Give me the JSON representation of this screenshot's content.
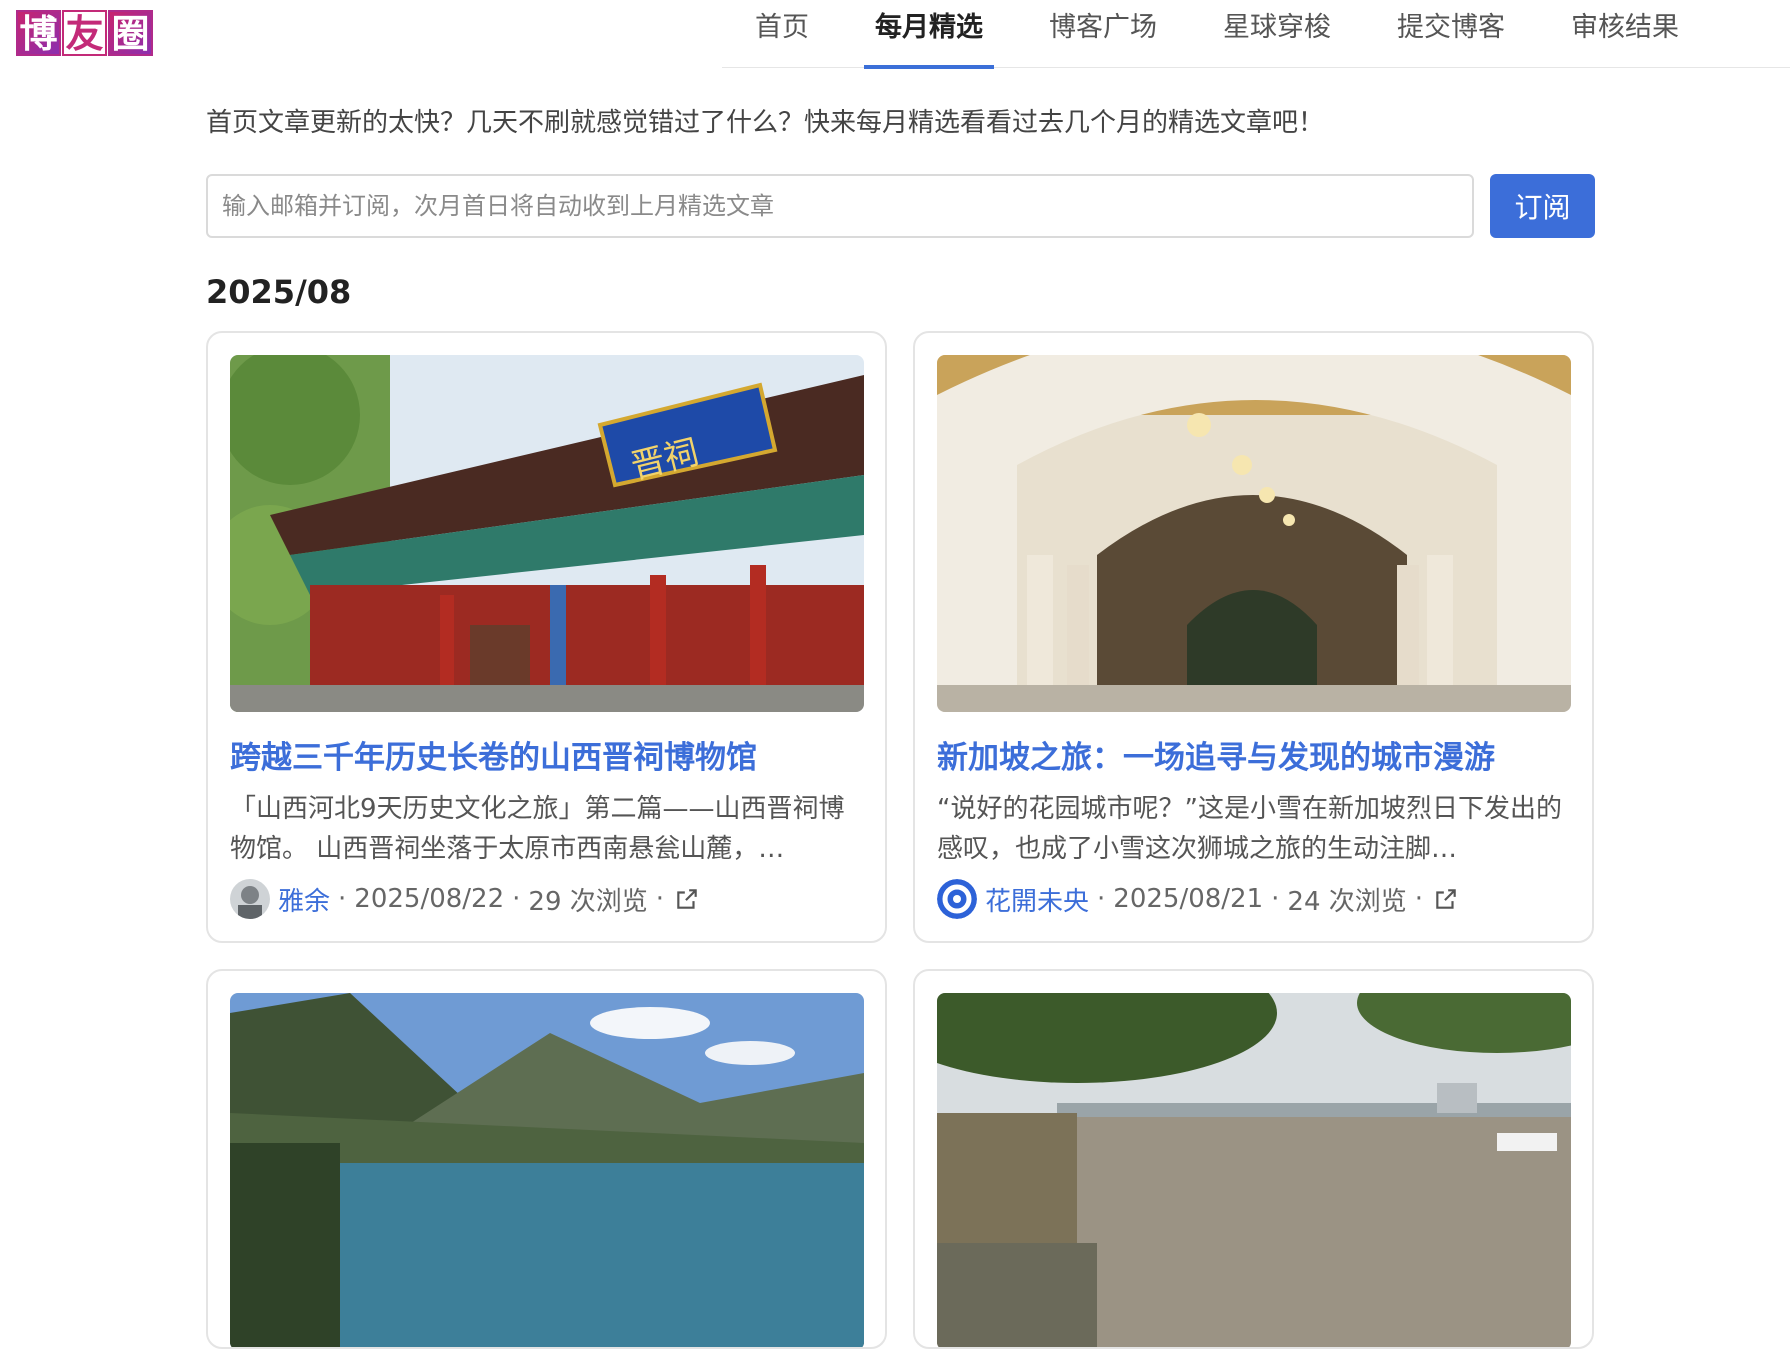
{
  "logo": {
    "chars": [
      "博",
      "友",
      "圈"
    ]
  },
  "nav": {
    "items": [
      {
        "label": "首页"
      },
      {
        "label": "每月精选"
      },
      {
        "label": "博客广场"
      },
      {
        "label": "星球穿梭"
      },
      {
        "label": "提交博客"
      },
      {
        "label": "审核结果"
      }
    ],
    "active_index": 1
  },
  "intro": "首页文章更新的太快？几天不刷就感觉错过了什么？快来每月精选看看过去几个月的精选文章吧！",
  "subscribe": {
    "placeholder": "输入邮箱并订阅，次月首日将自动收到上月精选文章",
    "value": "",
    "button_label": "订阅"
  },
  "month": "2025/08",
  "articles": [
    {
      "title": "跨越三千年历史长卷的山西晋祠博物馆",
      "excerpt": "「山西河北9天历史文化之旅」第二篇——山西晋祠博物馆。 山西晋祠坐落于太原市西南悬瓮山麓，…",
      "author": "雅余",
      "date": "2025/08/22",
      "views": "29 次浏览",
      "image": "temple-gate-photo",
      "plaque": "晋祠"
    },
    {
      "title": "新加坡之旅：一场追寻与发现的城市漫游",
      "excerpt": "“说好的花园城市呢？”这是小雪在新加坡烈日下发出的感叹，也成了小雪这次狮城之旅的生动注脚…",
      "author": "花開未央",
      "date": "2025/08/21",
      "views": "24 次浏览",
      "image": "colonnade-arches-photo"
    },
    {
      "image": "mountain-lake-photo"
    },
    {
      "image": "river-bridge-photo"
    }
  ],
  "colors": {
    "accent": "#3c6ed9",
    "brand": "#c32a78",
    "border": "#e4e4e4"
  }
}
